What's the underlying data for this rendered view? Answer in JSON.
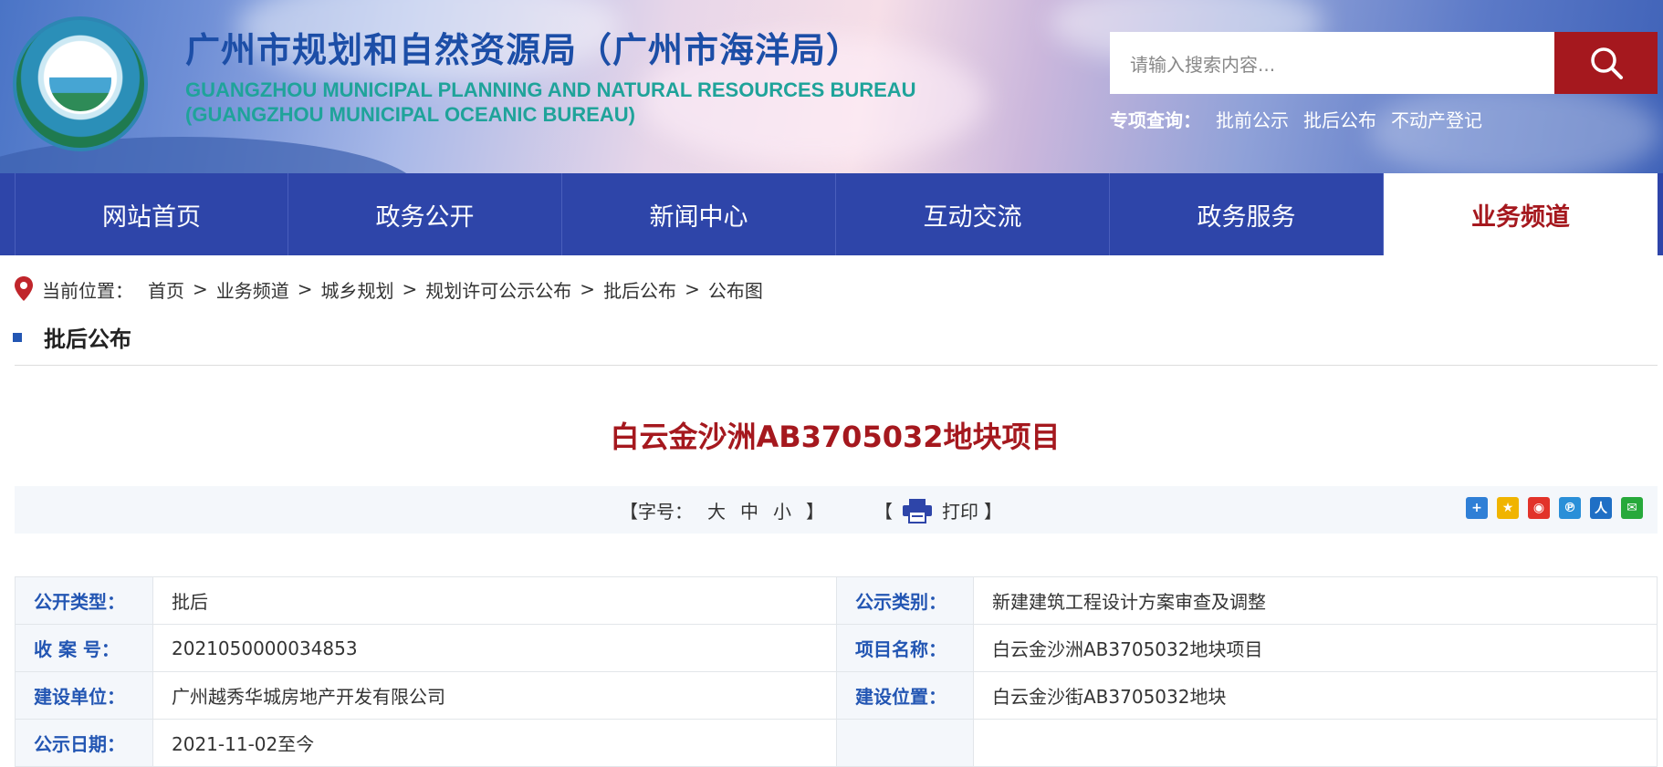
{
  "header": {
    "title_cn": "广州市规划和自然资源局（广州市海洋局）",
    "title_en_line1": "GUANGZHOU MUNICIPAL PLANNING AND NATURAL RESOURCES BUREAU",
    "title_en_line2": "(GUANGZHOU MUNICIPAL OCEANIC BUREAU)",
    "search_placeholder": "请输入搜索内容...",
    "search_icon": "search-icon",
    "special_label": "专项查询：",
    "special_links": [
      "批前公示",
      "批后公布",
      "不动产登记"
    ]
  },
  "nav": {
    "items": [
      "网站首页",
      "政务公开",
      "新闻中心",
      "互动交流",
      "政务服务",
      "业务频道"
    ],
    "active_index": 5
  },
  "breadcrumb": {
    "prefix": "当前位置：",
    "items": [
      "首页",
      "业务频道",
      "城乡规划",
      "规划许可公示公布",
      "批后公布",
      "公布图"
    ],
    "separator": ">"
  },
  "section_title": "批后公布",
  "article_title": "白云金沙洲AB3705032地块项目",
  "toolbar": {
    "font_label": "【字号：",
    "font_large": "大",
    "font_medium": "中",
    "font_small": "小",
    "font_close": "】",
    "print_open": "【",
    "print_label": "打印",
    "print_close": "】",
    "share_icons": [
      "plus-share-icon",
      "qzone-icon",
      "weibo-icon",
      "tencent-weibo-icon",
      "renren-icon",
      "wechat-icon"
    ]
  },
  "info": {
    "rows": [
      {
        "k1": "公开类型：",
        "v1": "批后",
        "k2": "公示类别：",
        "v2": "新建建筑工程设计方案审查及调整"
      },
      {
        "k1": "收 案 号：",
        "v1": "2021050000034853",
        "k2": "项目名称：",
        "v2": "白云金沙洲AB3705032地块项目"
      },
      {
        "k1": "建设单位：",
        "v1": "广州越秀华城房地产开发有限公司",
        "k2": "建设位置：",
        "v2": "白云金沙街AB3705032地块"
      },
      {
        "k1": "公示日期：",
        "v1": "2021-11-02至今",
        "k2": "",
        "v2": ""
      }
    ]
  },
  "colors": {
    "nav_bg": "#2e45a9",
    "accent_red": "#a5181e",
    "label_blue": "#2356b3"
  }
}
